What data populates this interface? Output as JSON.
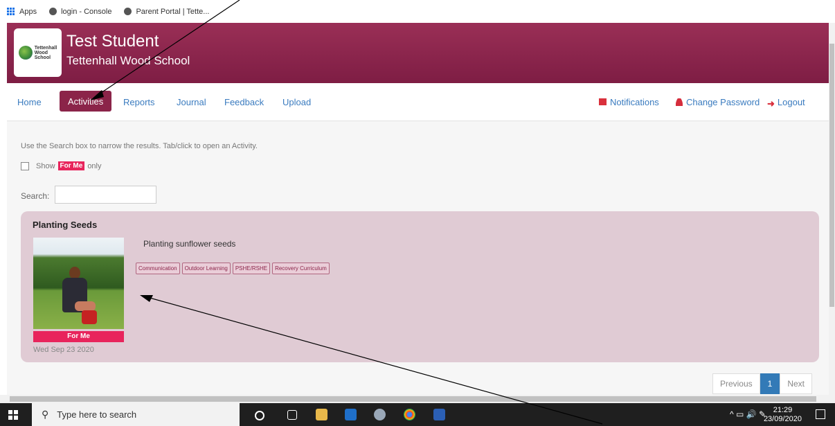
{
  "bookmarks": {
    "apps": "Apps",
    "items": [
      {
        "label": "login - Console"
      },
      {
        "label": "Parent Portal | Tette..."
      }
    ]
  },
  "header": {
    "student_name": "Test Student",
    "school_name": "Tettenhall Wood School",
    "logo_text_1": "Tettenhall",
    "logo_text_2": "Wood",
    "logo_text_3": "School"
  },
  "nav": {
    "home": "Home",
    "activities": "Activities",
    "reports": "Reports",
    "journal": "Journal",
    "feedback": "Feedback",
    "upload": "Upload",
    "notifications": "Notifications",
    "change_password": "Change Password",
    "logout": "Logout"
  },
  "content": {
    "help_text": "Use the Search box to narrow the results. Tab/click to open an Activity.",
    "show": "Show",
    "for_me": "For Me",
    "only": "only",
    "search_label": "Search:",
    "search_value": ""
  },
  "activity": {
    "title": "Planting Seeds",
    "description": "Planting sunflower seeds",
    "tags": [
      "Communication",
      "Outdoor Learning",
      "PSHE/RSHE",
      "Recovery Curriculum"
    ],
    "badge": "For Me",
    "date": "Wed Sep 23 2020"
  },
  "pager": {
    "previous": "Previous",
    "current": "1",
    "next": "Next"
  },
  "taskbar": {
    "search_placeholder": "Type here to search",
    "time": "21:29",
    "date": "23/09/2020"
  },
  "colors": {
    "brand": "#8b2449",
    "accent_pink": "#e8245c",
    "link": "#3a7bbf",
    "card_bg": "#e0cbd4"
  }
}
